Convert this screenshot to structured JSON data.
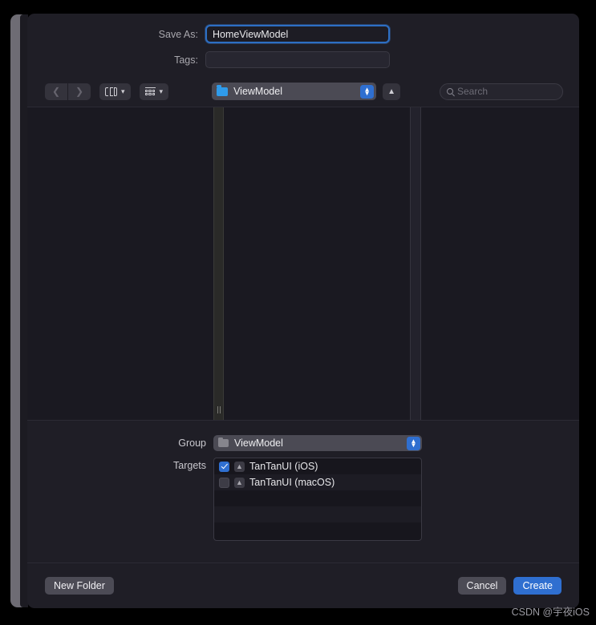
{
  "dialog": {
    "save_as": {
      "label": "Save As:",
      "value": "HomeViewModel"
    },
    "tags": {
      "label": "Tags:",
      "value": "",
      "placeholder": ""
    }
  },
  "toolbar": {
    "back_icon": "chevron-left-icon",
    "forward_icon": "chevron-right-icon",
    "view_mode_icon": "column-view-icon",
    "view_mode_chevron": "chevron-down-icon",
    "group_by_icon": "group-by-icon",
    "group_by_chevron": "chevron-down-icon",
    "path_popup": {
      "label": "ViewModel",
      "icon": "blue-folder-icon"
    },
    "up_button_icon": "chevron-up-icon",
    "search": {
      "placeholder": "Search",
      "icon": "search-icon"
    }
  },
  "browser": {
    "columns": [
      "",
      "",
      ""
    ],
    "resize_grip": "column-resize-grip"
  },
  "group": {
    "label": "Group",
    "value": "ViewModel",
    "icon": "gray-folder-icon"
  },
  "targets": {
    "label": "Targets",
    "items": [
      {
        "name": "TanTanUI (iOS)",
        "checked": true,
        "icon": "xcode-target-icon"
      },
      {
        "name": "TanTanUI (macOS)",
        "checked": false,
        "icon": "xcode-target-icon"
      }
    ]
  },
  "footer": {
    "new_folder": "New Folder",
    "cancel": "Cancel",
    "create": "Create"
  },
  "watermark": "CSDN @宇夜iOS",
  "colors": {
    "accent": "#2f6fd0",
    "dialog_bg": "#1f1e26",
    "browser_bg": "#1a1921",
    "control_bg": "#4b4a54",
    "text": "#e9e9ec"
  }
}
